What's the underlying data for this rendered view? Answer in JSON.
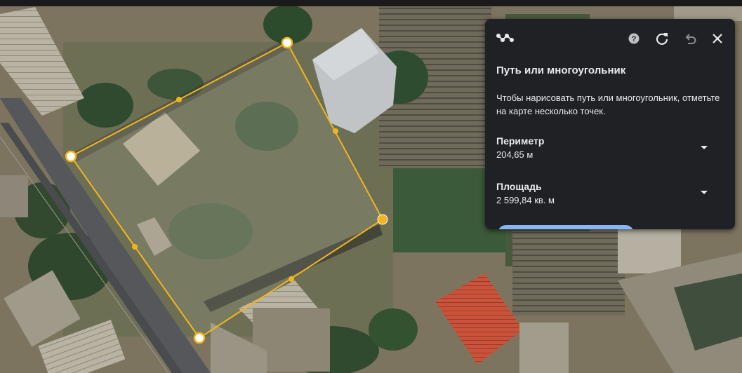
{
  "panel": {
    "title": "Путь или многоугольник",
    "description": "Чтобы нарисовать путь или многоугольник, отметьте на карте несколько точек.",
    "perimeter_label": "Периметр",
    "perimeter_value": "204,65 м",
    "area_label": "Площадь",
    "area_value": "2 599,84 кв. м",
    "icons": {
      "tool": "path-measure-icon",
      "help": "help-icon",
      "refresh": "refresh-icon",
      "undo": "undo-icon",
      "close": "close-icon",
      "dropdown": "chevron-down-icon"
    }
  },
  "colors": {
    "polygon_stroke": "#f2b51d",
    "panel_bg": "#202124",
    "accent_button": "#8ab4f8"
  }
}
